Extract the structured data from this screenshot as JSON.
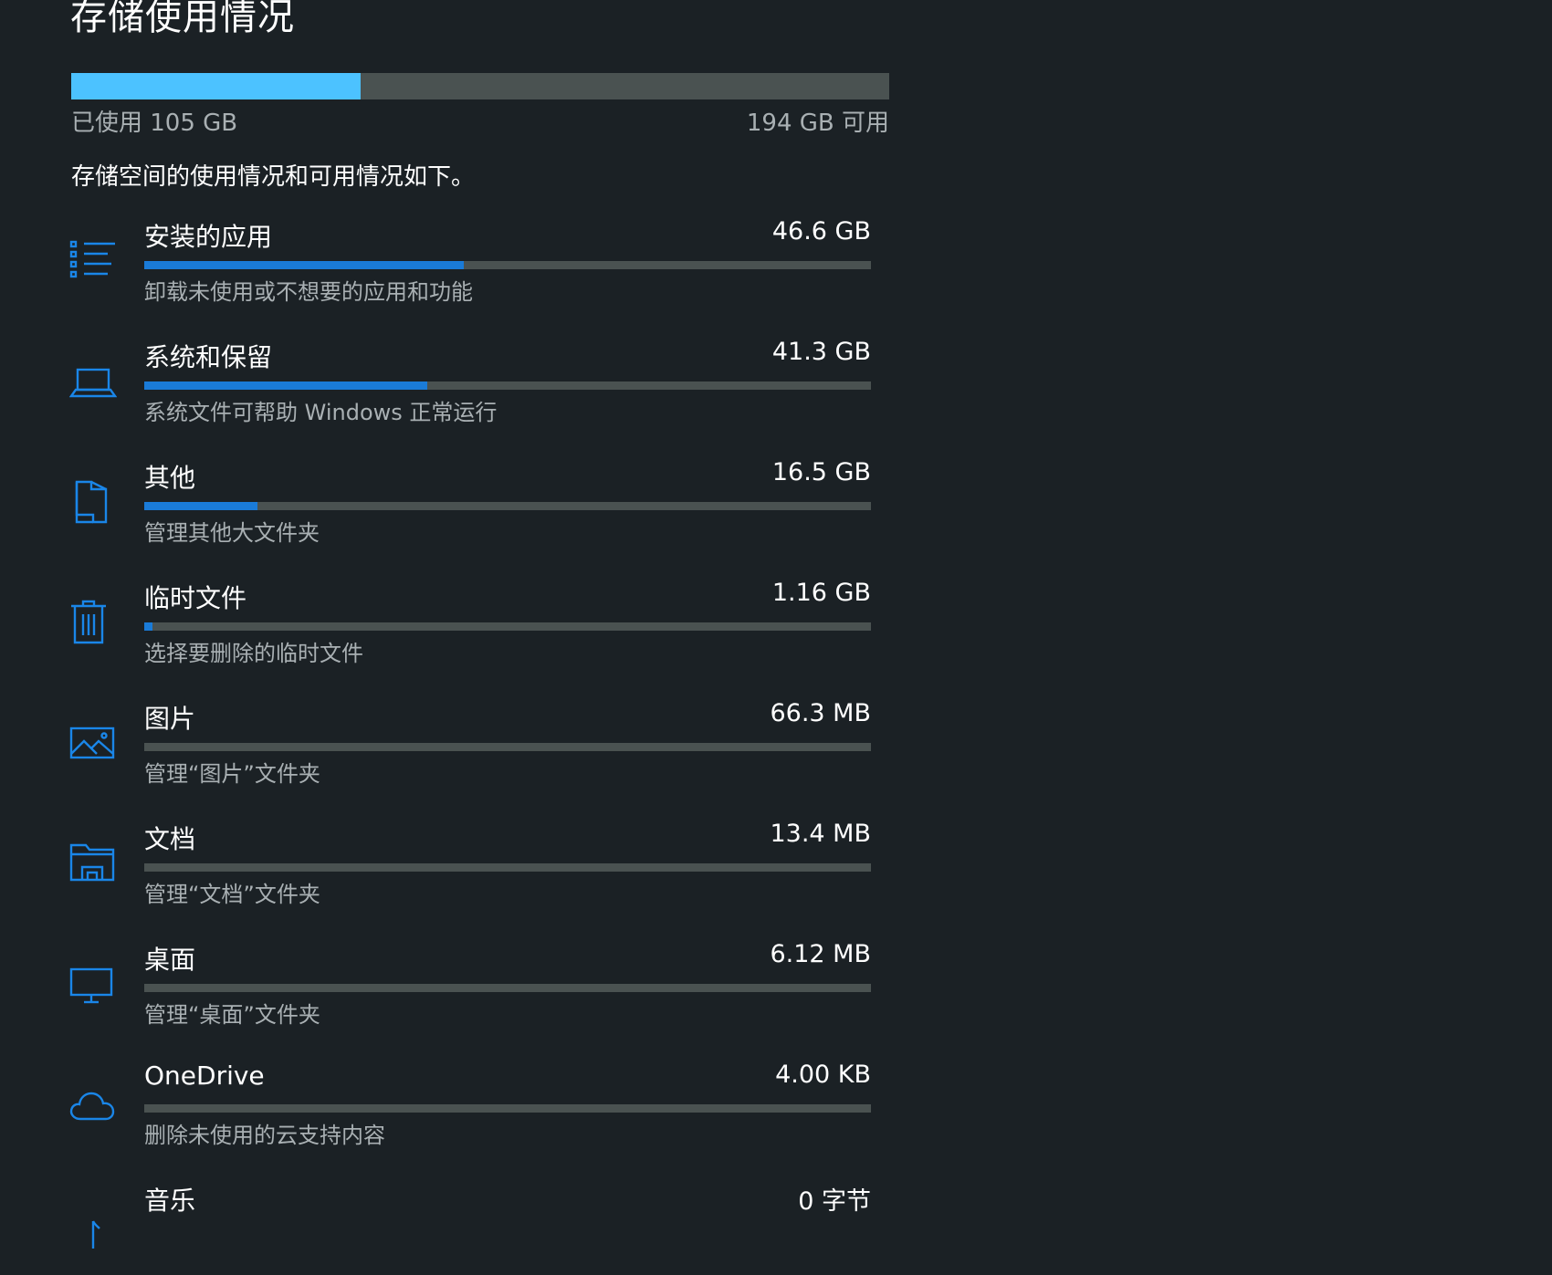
{
  "page": {
    "title": "存储使用情况",
    "used_label": "已使用 105 GB",
    "free_label": "194 GB 可用",
    "used_fraction": 0.354,
    "description": "存储空间的使用情况和可用情况如下。"
  },
  "colors": {
    "background": "#1b2125",
    "total_bar_fill": "#4cc2ff",
    "track": "#4a5251",
    "category_fill": "#1a7bd8",
    "icon": "#1a86e8",
    "secondary_text": "#a9b0b3"
  },
  "categories": [
    {
      "name": "安装的应用",
      "size": "46.6 GB",
      "subtitle": "卸载未使用或不想要的应用和功能",
      "icon": "apps-list-icon",
      "fraction": 0.44
    },
    {
      "name": "系统和保留",
      "size": "41.3 GB",
      "subtitle": "系统文件可帮助 Windows 正常运行",
      "icon": "laptop-icon",
      "fraction": 0.39
    },
    {
      "name": "其他",
      "size": "16.5 GB",
      "subtitle": "管理其他大文件夹",
      "icon": "folder-other-icon",
      "fraction": 0.156
    },
    {
      "name": "临时文件",
      "size": "1.16 GB",
      "subtitle": "选择要删除的临时文件",
      "icon": "trash-icon",
      "fraction": 0.011
    },
    {
      "name": "图片",
      "size": "66.3 MB",
      "subtitle": "管理“图片”文件夹",
      "icon": "picture-icon",
      "fraction": 0.0
    },
    {
      "name": "文档",
      "size": "13.4 MB",
      "subtitle": "管理“文档”文件夹",
      "icon": "documents-folder-icon",
      "fraction": 0.0
    },
    {
      "name": "桌面",
      "size": "6.12 MB",
      "subtitle": "管理“桌面”文件夹",
      "icon": "monitor-icon",
      "fraction": 0.0
    },
    {
      "name": "OneDrive",
      "size": "4.00 KB",
      "subtitle": "删除未使用的云支持内容",
      "icon": "cloud-icon",
      "fraction": 0.0
    },
    {
      "name": "音乐",
      "size": "0 字节",
      "subtitle": "",
      "icon": "music-note-icon",
      "fraction": 0.0
    }
  ]
}
